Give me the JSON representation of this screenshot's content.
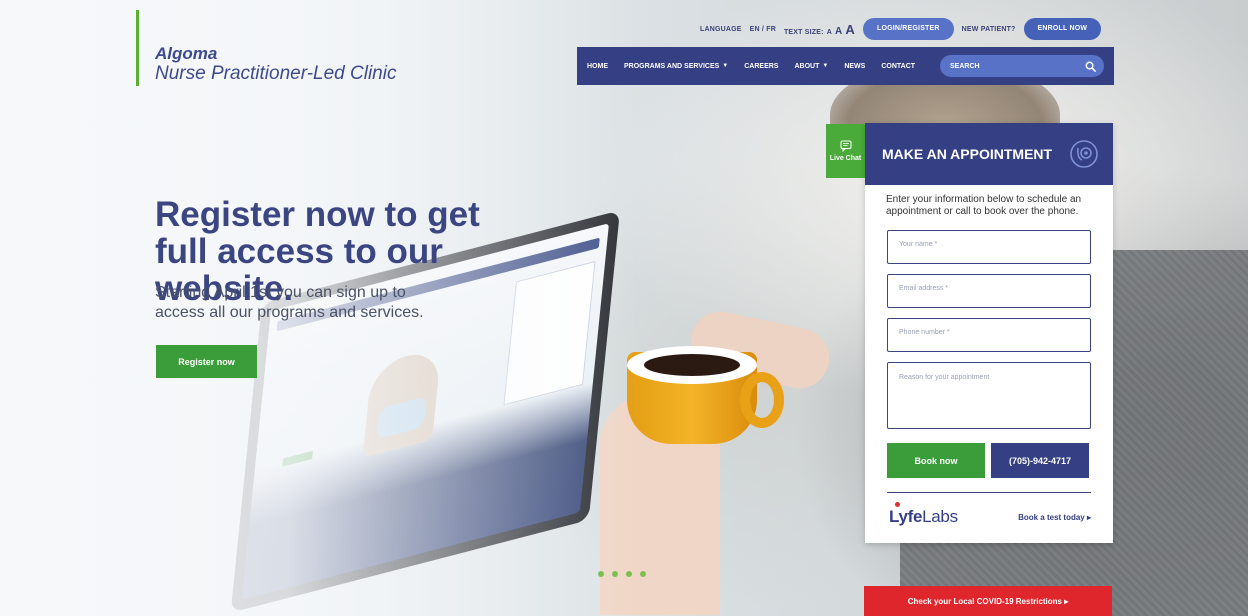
{
  "brand": {
    "line1": "Algoma",
    "line2": "Nurse Practitioner-Led Clinic"
  },
  "utility": {
    "language_label": "LANGUAGE",
    "language_value": "EN / FR",
    "text_size_label": "TEXT SIZE:",
    "size_small": "A",
    "size_medium": "A",
    "size_large": "A",
    "login_label": "LOGIN/REGISTER",
    "new_patient_label": "NEW PATIENT?",
    "enroll_label": "ENROLL NOW"
  },
  "nav": {
    "items": [
      {
        "label": "HOME",
        "caret": false
      },
      {
        "label": "PROGRAMS AND SERVICES",
        "caret": true
      },
      {
        "label": "CAREERS",
        "caret": false
      },
      {
        "label": "ABOUT",
        "caret": true
      },
      {
        "label": "NEWS",
        "caret": false
      },
      {
        "label": "CONTACT",
        "caret": false
      }
    ],
    "search_placeholder": "SEARCH"
  },
  "hero": {
    "title": "Register now to get full access to our website.",
    "subtitle": "Starting April 1st you can sign up to access all our programs and services.",
    "cta": "Register now",
    "slide_count": 4
  },
  "livechat": {
    "label": "Live Chat"
  },
  "appointment": {
    "title": "MAKE AN APPOINTMENT",
    "description": "Enter your information below to schedule an appointment or call to book over the phone.",
    "fields": {
      "name": "Your name *",
      "email": "Email address *",
      "phone": "Phone number *",
      "reason": "Reason for your appointment"
    },
    "book_label": "Book now",
    "phone_label": "(705)-942-4717"
  },
  "lifelabs": {
    "logo_part1": "Lyfe",
    "logo_part2": "Labs",
    "link": "Book a test today ▸"
  },
  "covid": {
    "label": "Check your Local COVID-19 Restrictions ▸"
  },
  "colors": {
    "navy": "#353f84",
    "blue_pill": "#5872c7",
    "green": "#3a9d3a",
    "red": "#e0262d"
  }
}
